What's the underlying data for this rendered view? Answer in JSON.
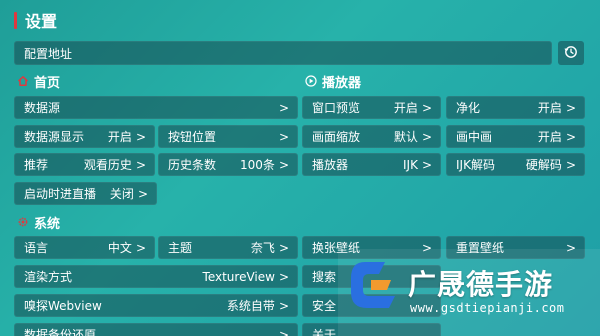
{
  "header": {
    "title": "设置"
  },
  "config": {
    "label": "配置地址"
  },
  "sections": {
    "home": "首页",
    "player": "播放器",
    "system": "系统"
  },
  "home": {
    "datasource": {
      "label": "数据源",
      "value": ""
    },
    "datasource_display": {
      "label": "数据源显示",
      "value": "开启"
    },
    "button_position": {
      "label": "按钮位置",
      "value": ""
    },
    "recommend": {
      "label": "推荐",
      "value": "观看历史"
    },
    "history_count": {
      "label": "历史条数",
      "value": "100条"
    },
    "boot_live": {
      "label": "启动时进直播",
      "value": "关闭"
    }
  },
  "player": {
    "window_preview": {
      "label": "窗口预览",
      "value": "开启"
    },
    "purify": {
      "label": "净化",
      "value": "开启"
    },
    "scale": {
      "label": "画面缩放",
      "value": "默认"
    },
    "pip": {
      "label": "画中画",
      "value": "开启"
    },
    "player": {
      "label": "播放器",
      "value": "IJK"
    },
    "ijk_decode": {
      "label": "IJK解码",
      "value": "硬解码"
    }
  },
  "system": {
    "language": {
      "label": "语言",
      "value": "中文"
    },
    "theme": {
      "label": "主题",
      "value": "奈飞"
    },
    "change_wallpaper": {
      "label": "换张壁纸",
      "value": ""
    },
    "reset_wallpaper": {
      "label": "重置壁纸",
      "value": ""
    },
    "render": {
      "label": "渲染方式",
      "value": "TextureView"
    },
    "search": {
      "label": "搜索",
      "value": ""
    },
    "sniff_webview": {
      "label": "嗅探Webview",
      "value": "系统自带"
    },
    "security": {
      "label": "安全",
      "value": ""
    },
    "backup": {
      "label": "数据备份还原",
      "value": ""
    },
    "about": {
      "label": "关于",
      "value": ""
    }
  },
  "chevron": ">",
  "icons": {
    "home": "house-icon",
    "player": "play-circle-icon",
    "system": "gear-icon",
    "history": "clock-history-icon"
  },
  "colors": {
    "accent": "#e0383e",
    "background": "#23a9a3",
    "watermark_logo_blue": "#2a6fe0",
    "watermark_logo_orange": "#f29a2e"
  },
  "watermark": {
    "text": "广晟德手游",
    "url": "www.gsdtiepianji.com"
  }
}
